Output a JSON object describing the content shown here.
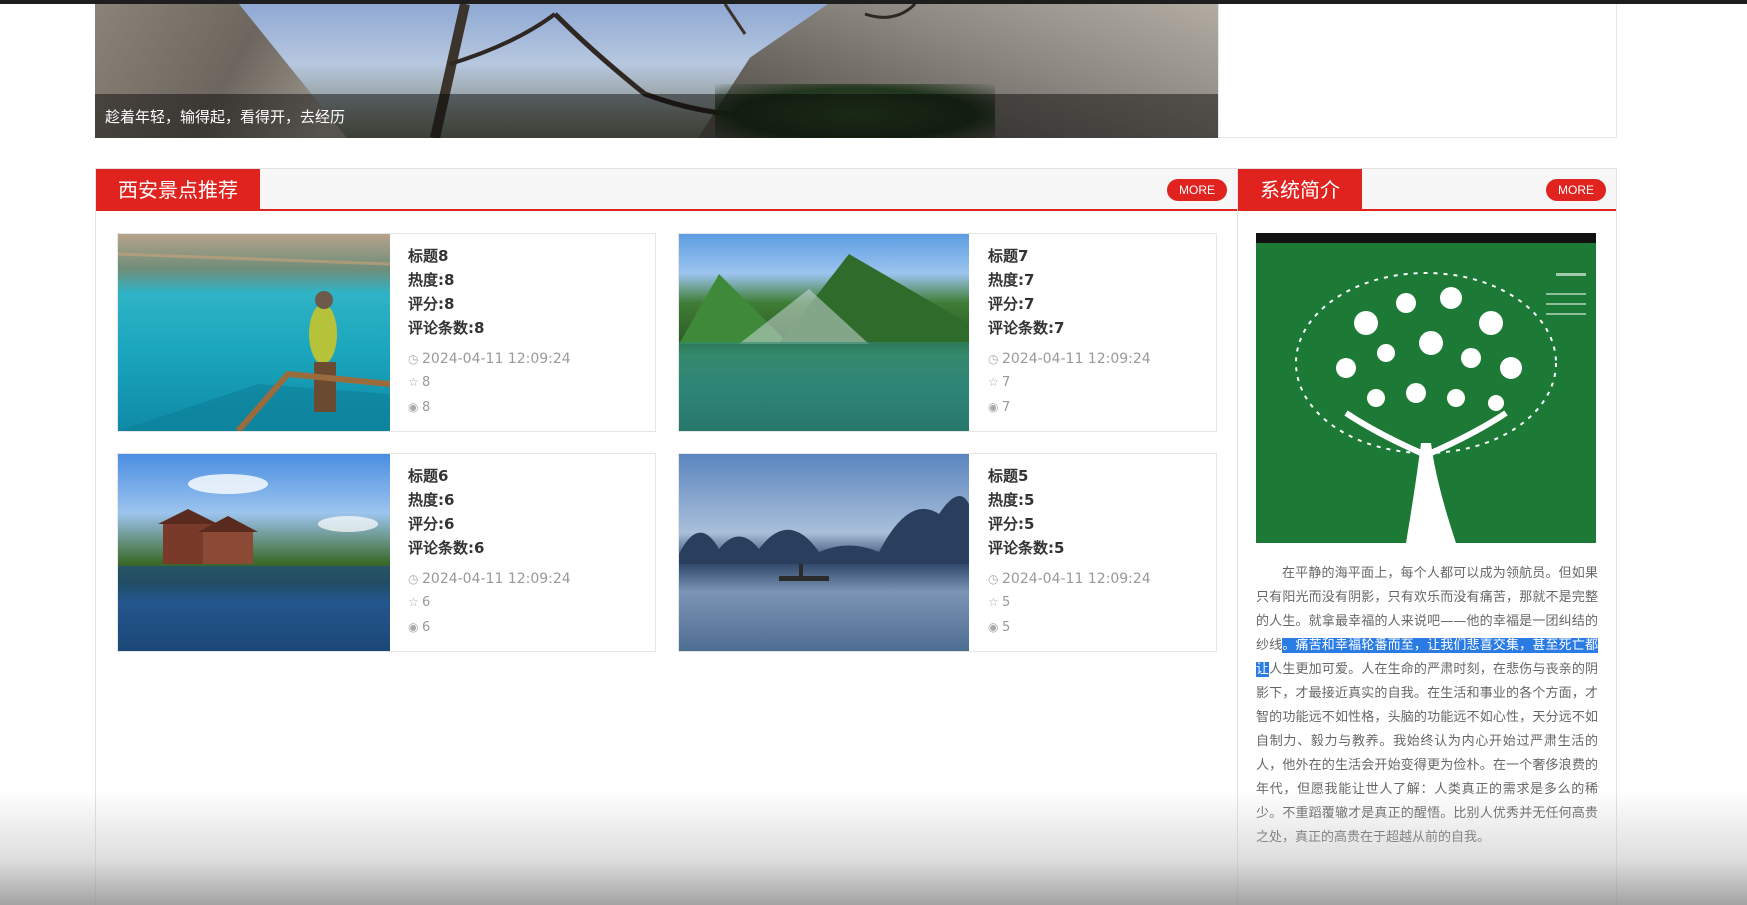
{
  "banner": {
    "caption": "趁着年轻，输得起，看得开，去经历",
    "dots": 3,
    "active_dot": 0
  },
  "attractions": {
    "title": "西安景点推荐",
    "more_label": "MORE",
    "cards": [
      {
        "title": "标题8",
        "heat": "热度:8",
        "rating": "评分:8",
        "comments": "评论条数:8",
        "time": "2024-04-11 12:09:24",
        "stars": "8",
        "views": "8"
      },
      {
        "title": "标题7",
        "heat": "热度:7",
        "rating": "评分:7",
        "comments": "评论条数:7",
        "time": "2024-04-11 12:09:24",
        "stars": "7",
        "views": "7"
      },
      {
        "title": "标题6",
        "heat": "热度:6",
        "rating": "评分:6",
        "comments": "评论条数:6",
        "time": "2024-04-11 12:09:24",
        "stars": "6",
        "views": "6"
      },
      {
        "title": "标题5",
        "heat": "热度:5",
        "rating": "评分:5",
        "comments": "评论条数:5",
        "time": "2024-04-11 12:09:24",
        "stars": "5",
        "views": "5"
      }
    ]
  },
  "intro": {
    "title": "系统简介",
    "more_label": "MORE",
    "text_before": "在平静的海平面上，每个人都可以成为领航员。但如果只有阳光而没有阴影，只有欢乐而没有痛苦，那就不是完整的人生。就拿最幸福的人来说吧——他的幸福是一团纠结的纱线",
    "text_highlight": "。痛苦和幸福轮番而至，让我们悲喜交集，甚至死亡都让",
    "text_after": "人生更加可爱。人在生命的严肃时刻，在悲伤与丧亲的阴影下，才最接近真实的自我。在生活和事业的各个方面，才智的功能远不如性格，头脑的功能远不如心性，天分远不如自制力、毅力与教养。我始终认为内心开始过严肃生活的人，他外在的生活会开始变得更为俭朴。在一个奢侈浪费的年代，但愿我能让世人了解：人类真正的需求是多么的稀少。不重蹈覆辙才是真正的醒悟。比别人优秀并无任何高贵之处，真正的高贵在于超越从前的自我。"
  },
  "colors": {
    "accent": "#e0231f",
    "selection": "#2a7be4"
  }
}
